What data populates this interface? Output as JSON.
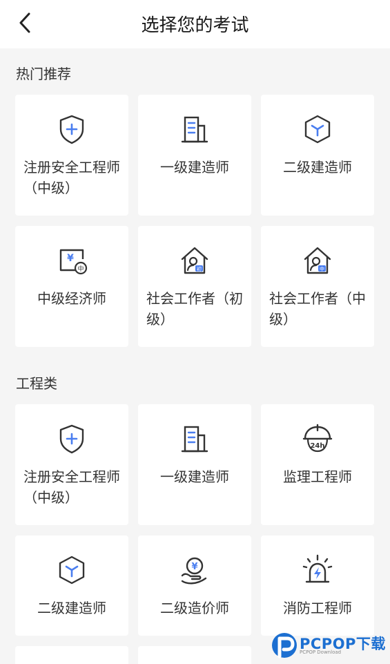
{
  "header": {
    "title": "选择您的考试",
    "back_icon": "chevron-left-icon"
  },
  "sections": [
    {
      "title": "热门推荐",
      "items": [
        {
          "label": "注册安全工程师（中级）",
          "icon": "shield-plus-icon"
        },
        {
          "label": "一级建造师",
          "icon": "building-icon"
        },
        {
          "label": "二级建造师",
          "icon": "hexagon-cube-icon"
        },
        {
          "label": "中级经济师",
          "icon": "yuan-board-icon"
        },
        {
          "label": "社会工作者（初级）",
          "icon": "house-person-icon"
        },
        {
          "label": "社会工作者（中级）",
          "icon": "house-person-icon"
        }
      ]
    },
    {
      "title": "工程类",
      "items": [
        {
          "label": "注册安全工程师（中级）",
          "icon": "shield-plus-icon"
        },
        {
          "label": "一级建造师",
          "icon": "building-icon"
        },
        {
          "label": "监理工程师",
          "icon": "helmet-24h-icon"
        },
        {
          "label": "二级建造师",
          "icon": "hexagon-cube-icon"
        },
        {
          "label": "二级造价师",
          "icon": "hand-yuan-icon"
        },
        {
          "label": "消防工程师",
          "icon": "alarm-light-icon"
        }
      ]
    }
  ],
  "icon_badges": {
    "junior": "初",
    "intermediate": "中",
    "hours": "24h",
    "yuan": "¥"
  },
  "watermark": {
    "brand": "PCPOP下载",
    "sub": "PCPOP Download"
  },
  "colors": {
    "accent": "#4a7ef0",
    "stroke": "#333333",
    "watermark": "#1c6fd1"
  }
}
